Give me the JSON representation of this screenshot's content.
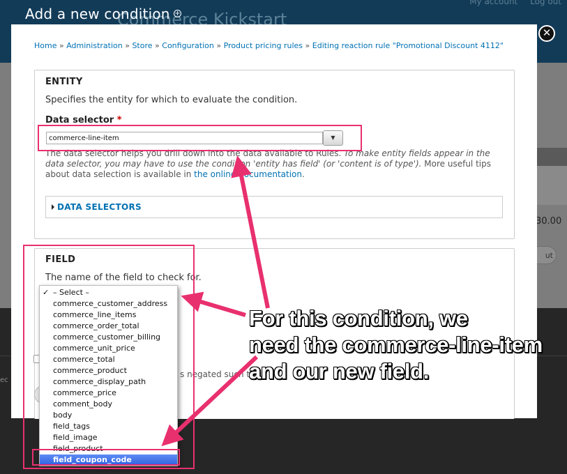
{
  "background": {
    "site_name": "Commerce Kickstart",
    "top_links": [
      "My account",
      "Log out"
    ],
    "price_fragment": "30.00",
    "pill_fragment": "ut",
    "left_fragment": "ec",
    "negate_text": "s negated such th"
  },
  "overlay": {
    "title": "Add a new condition",
    "close_icon": "close-icon"
  },
  "breadcrumb": [
    "Home",
    "Administration",
    "Store",
    "Configuration",
    "Product pricing rules",
    "Editing reaction rule \"Promotional Discount 4112\""
  ],
  "entity": {
    "legend": "ENTITY",
    "description": "Specifies the entity for which to evaluate the condition.",
    "data_selector_label": "Data selector",
    "required_marker": "*",
    "data_selector_value": "commerce-line-item",
    "help_part1": "The data selector helps you drill down into the data available to Rules. ",
    "help_em": "To make entity fields appear in the data selector, you may have to use the condition 'entity has field' (or 'content is of type').",
    "help_part2": " More useful tips about data selection is available in ",
    "help_link": "the online documentation",
    "help_end": ".",
    "data_selectors_label": "DATA SELECTORS"
  },
  "field": {
    "legend": "FIELD",
    "description": "The name of the field to check for.",
    "options": [
      "– Select –",
      "commerce_customer_address",
      "commerce_line_items",
      "commerce_order_total",
      "commerce_customer_billing",
      "commerce_unit_price",
      "commerce_total",
      "commerce_product",
      "commerce_display_path",
      "commerce_price",
      "comment_body",
      "body",
      "field_tags",
      "field_image",
      "field_product",
      "field_coupon_code"
    ],
    "checked_index": 0,
    "selected_index": 15
  },
  "annotation": {
    "lines": [
      "For this condition, we",
      "need the commerce-line-item",
      "and our new field."
    ],
    "color": "#e8306f"
  }
}
